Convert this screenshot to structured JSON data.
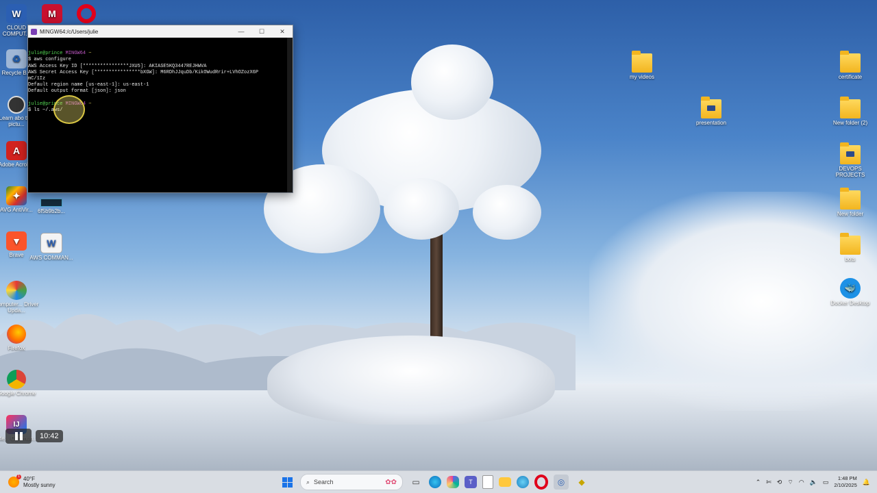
{
  "desktop": {
    "left_icons": [
      {
        "label": "CLOUD COMPUT...",
        "icon": "word-doc-icon"
      },
      {
        "label": "",
        "icon": "mcafee-icon"
      },
      {
        "label": "",
        "icon": "opera-icon"
      },
      {
        "label": "Recycle B...",
        "icon": "recycle-bin-icon"
      },
      {
        "label": "Learn abo this pictu...",
        "icon": "learn-picture-icon"
      },
      {
        "label": "Adobe Acrobat",
        "icon": "adobe-acrobat-icon"
      },
      {
        "label": "AVG AntiVir...",
        "icon": "avg-antivirus-icon"
      },
      {
        "label": "6f5b9b2b...",
        "icon": "image-file-icon"
      },
      {
        "label": "Brave",
        "icon": "brave-icon"
      },
      {
        "label": "AWS COMMAN...",
        "icon": "word-doc-icon"
      },
      {
        "label": "Computer... Driver Upda...",
        "icon": "driver-update-icon"
      },
      {
        "label": "Firefox",
        "icon": "firefox-icon"
      },
      {
        "label": "Google Chrome",
        "icon": "chrome-icon"
      },
      {
        "label": "Inte... Commun...",
        "icon": "intellij-icon"
      }
    ],
    "right_icons": [
      {
        "label": "my videos",
        "icon": "folder-icon"
      },
      {
        "label": "certificate",
        "icon": "folder-icon"
      },
      {
        "label": "presentation",
        "icon": "folder-icon"
      },
      {
        "label": "New folder (2)",
        "icon": "folder-icon"
      },
      {
        "label": "DEVOPS PROJECTS",
        "icon": "folder-icon"
      },
      {
        "label": "New folder",
        "icon": "folder-icon"
      },
      {
        "label": "bots",
        "icon": "folder-icon"
      },
      {
        "label": "Docker Desktop",
        "icon": "docker-icon"
      }
    ]
  },
  "terminal": {
    "title": "MINGW64:/c/Users/julie",
    "lines": [
      {
        "user": "julie@prince",
        "env": "MINGW64",
        "path": "~"
      },
      {
        "text": "$ aws configure"
      },
      {
        "text": "AWS Access Key ID [****************JXU5]: AKIASE5KQ3447REJHWVA"
      },
      {
        "text": "AWS Secret Access Key [****************bXGW]: M6RDhJJquDb/KikOWudRrir+LVhOZozX6P"
      },
      {
        "text": "mC/1Iz"
      },
      {
        "text": "Default region name [us-east-1]: us-east-1"
      },
      {
        "text": "Default output format [json]: json"
      },
      {
        "text": ""
      },
      {
        "user": "julie@prince",
        "env": "MINGW64",
        "path": "~"
      },
      {
        "text": "$ ls ~/.aws/"
      }
    ]
  },
  "video": {
    "time": "10:42"
  },
  "taskbar": {
    "weather_temp": "40°F",
    "weather_desc": "Mostly sunny",
    "search_placeholder": "Search",
    "time": "1:48 PM",
    "date": "2/10/2025",
    "notification_count": "1"
  },
  "colors": {
    "accent": "#1a73e8",
    "terminal_bg": "#000000",
    "prompt_user": "#53d553",
    "prompt_env": "#c35ac8",
    "prompt_path": "#d6c95a"
  }
}
